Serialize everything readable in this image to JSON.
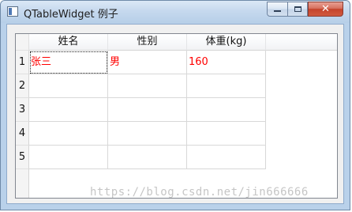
{
  "window": {
    "title": "QTableWidget 例子",
    "minimize_label": "",
    "maximize_label": "",
    "close_label": "✕"
  },
  "table": {
    "columns": [
      "姓名",
      "性别",
      "体重(kg)"
    ],
    "row_numbers": [
      "1",
      "2",
      "3",
      "4",
      "5"
    ],
    "rows": [
      [
        "张三",
        "男",
        "160"
      ],
      [
        "",
        "",
        ""
      ],
      [
        "",
        "",
        ""
      ],
      [
        "",
        "",
        ""
      ],
      [
        "",
        "",
        ""
      ]
    ],
    "cell_text_color": "#ff0000",
    "current_cell": {
      "row": 0,
      "column": 0
    }
  },
  "watermark": "https://blog.csdn.net/jin666666"
}
